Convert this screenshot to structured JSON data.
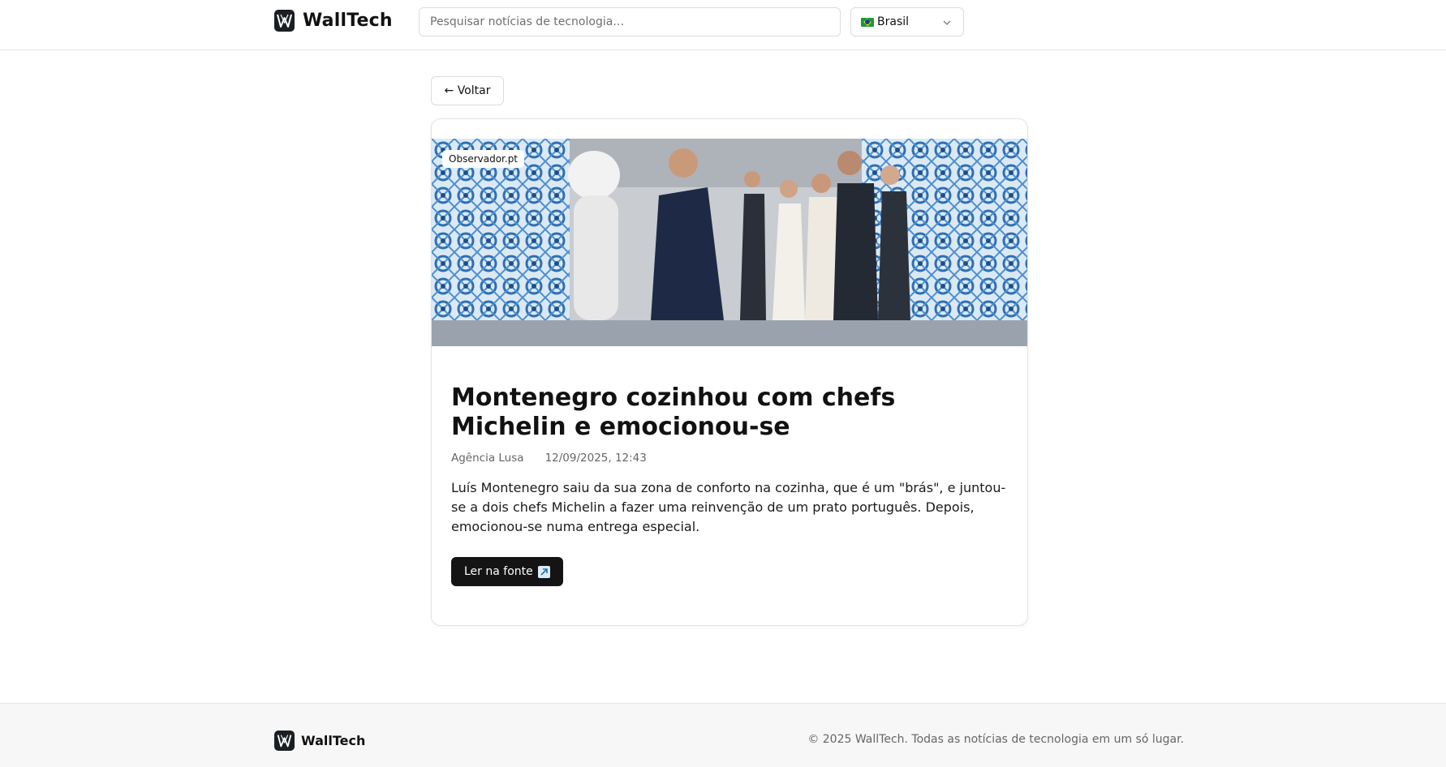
{
  "header": {
    "brand": "WallTech",
    "search_placeholder": "Pesquisar notícias de tecnologia…",
    "country": "Brasil",
    "country_flag": "brazil-flag-icon"
  },
  "back_label": "← Voltar",
  "article": {
    "source_badge": "Observador.pt",
    "title": "Montenegro cozinhou com chefs Michelin e emocionou-se",
    "author": "Agência Lusa",
    "date": "12/09/2025, 12:43",
    "summary": "Luís Montenegro saiu da sua zona de conforto na cozinha, que é um \"brás\", e juntou-se a dois chefs Michelin a fazer uma reinvenção de um prato português. Depois, emocionou-se numa entrega especial.",
    "cta_label": "Ler na fonte",
    "cta_icon": "external-link-icon"
  },
  "footer": {
    "brand": "WallTech",
    "copyright": "© 2025 WallTech. Todas as notícias de tecnologia em um só lugar."
  },
  "colors": {
    "primary_button": "#141414",
    "border": "#dcdcdc",
    "muted_text": "#666666"
  }
}
